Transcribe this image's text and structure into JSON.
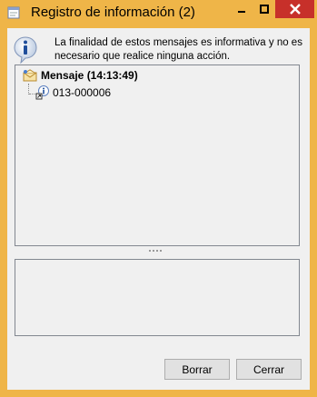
{
  "window": {
    "title": "Registro de información (2)",
    "accent_color": "#efb548",
    "close_color": "#c7302a"
  },
  "intro": {
    "text": "La finalidad de estos mensajes es informativa y no es necesario que realice ninguna acción."
  },
  "tree": {
    "root_label": "Mensaje (14:13:49)",
    "root_icon": "message-envelope-icon",
    "children": [
      {
        "label": "013-000006",
        "icon": "info-message-icon"
      }
    ]
  },
  "buttons": {
    "clear_label": "Borrar",
    "close_label": "Cerrar"
  }
}
